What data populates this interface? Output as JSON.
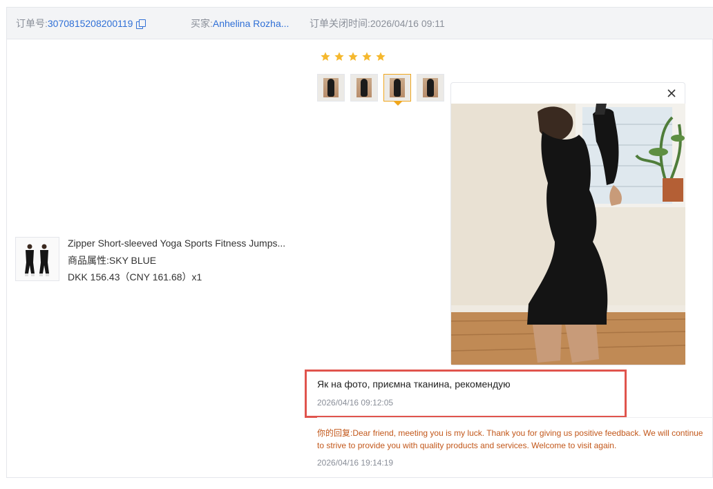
{
  "header": {
    "order_label": "订单号:",
    "order_number": "3070815208200119",
    "buyer_label": "买家:",
    "buyer_name": "Anhelina Rozha...",
    "close_time": "订单关闭时间:2026/04/16 09:11"
  },
  "product": {
    "title": "Zipper Short-sleeved Yoga Sports Fitness Jumps...",
    "attribute": "商品属性:SKY BLUE",
    "price": "DKK 156.43（CNY  161.68）x1"
  },
  "review": {
    "rating": 5,
    "rating_max": 5,
    "star_color": "#f5b82e",
    "thumbnail_count": 4,
    "selected_thumbnail": 3,
    "text": "Як на фото, приємна тканина, рекомендую",
    "time": "2026/04/16 09:12:05"
  },
  "reply": {
    "label": "你的回复:",
    "text": "Dear friend, meeting you is my luck. Thank you for giving us positive feedback. We will continue to strive to provide you with quality products and services. Welcome to visit again.",
    "time": "2026/04/16 19:14:19"
  },
  "colors": {
    "link": "#2f6fd6",
    "highlight_border": "#e0544d",
    "reply_text": "#c2571a",
    "selected_thumb": "#f0a61b"
  }
}
